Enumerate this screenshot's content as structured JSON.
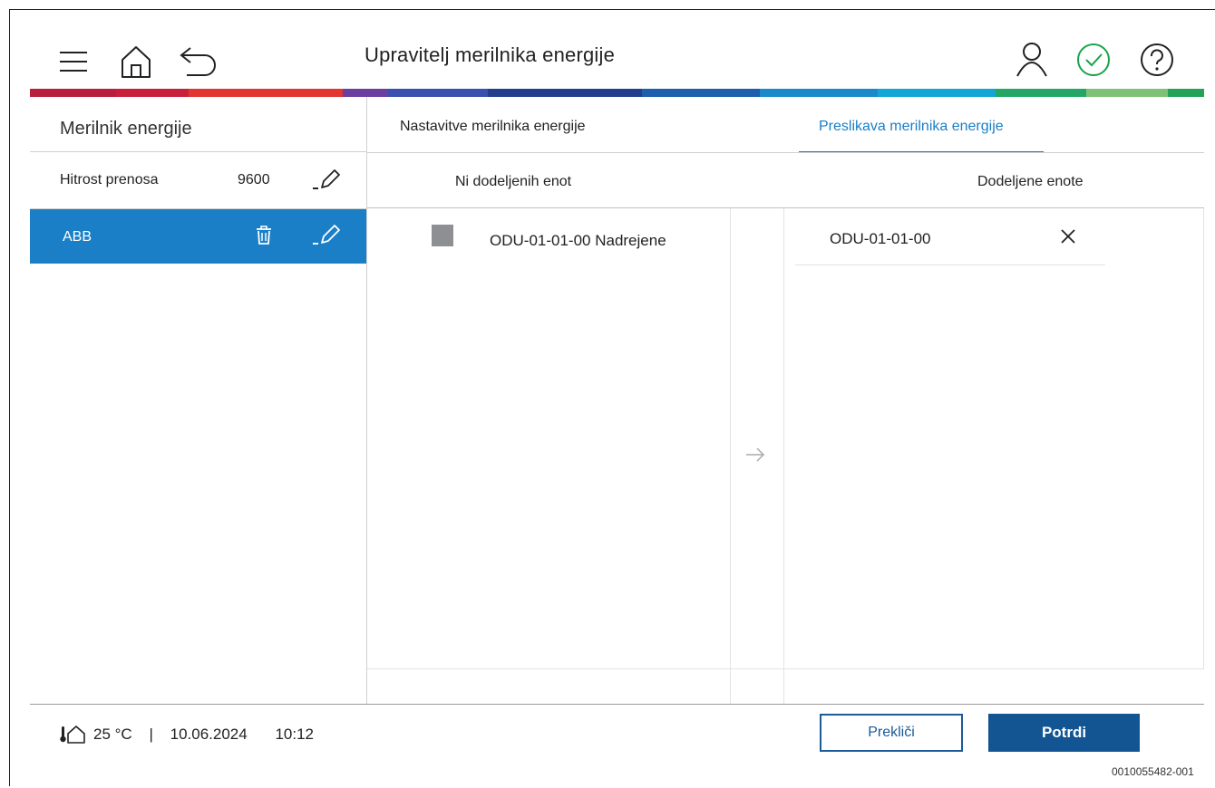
{
  "header": {
    "title": "Upravitelj merilnika energije",
    "icons": [
      "menu-icon",
      "home-icon",
      "back-icon",
      "user-icon",
      "status-ok-icon",
      "help-icon"
    ],
    "status_color": "#1aa34a"
  },
  "sidebar": {
    "title": "Merilnik energije",
    "transfer_rate": {
      "label": "Hitrost prenosa",
      "value": "9600"
    },
    "meters": [
      {
        "name": "ABB",
        "selected": true
      }
    ]
  },
  "tabs": [
    {
      "label": "Nastavitve merilnika energije",
      "active": false
    },
    {
      "label": "Preslikava merilnika energije",
      "active": true
    }
  ],
  "mapping": {
    "unassigned_header": "Ni dodeljenih enot",
    "assigned_header": "Dodeljene enote",
    "unassigned": [
      {
        "label": "ODU-01-01-00 Nadrejene"
      }
    ],
    "assigned": [
      {
        "label": "ODU-01-01-00"
      }
    ]
  },
  "footer": {
    "temperature": "25 °C",
    "separator": "|",
    "date": "10.06.2024",
    "time": "10:12",
    "cancel_label": "Prekliči",
    "confirm_label": "Potrdi"
  },
  "document_id": "0010055482-001",
  "colors": {
    "accent": "#1a7fc7",
    "primary_button": "#125592",
    "stripe": [
      "#b81f3c",
      "#c8203b",
      "#e23430",
      "#6b3fa0",
      "#3b4faf",
      "#233f8c",
      "#1d5fad",
      "#1b8acb",
      "#12a6d5",
      "#24a766",
      "#7fc277",
      "#24a356"
    ]
  }
}
